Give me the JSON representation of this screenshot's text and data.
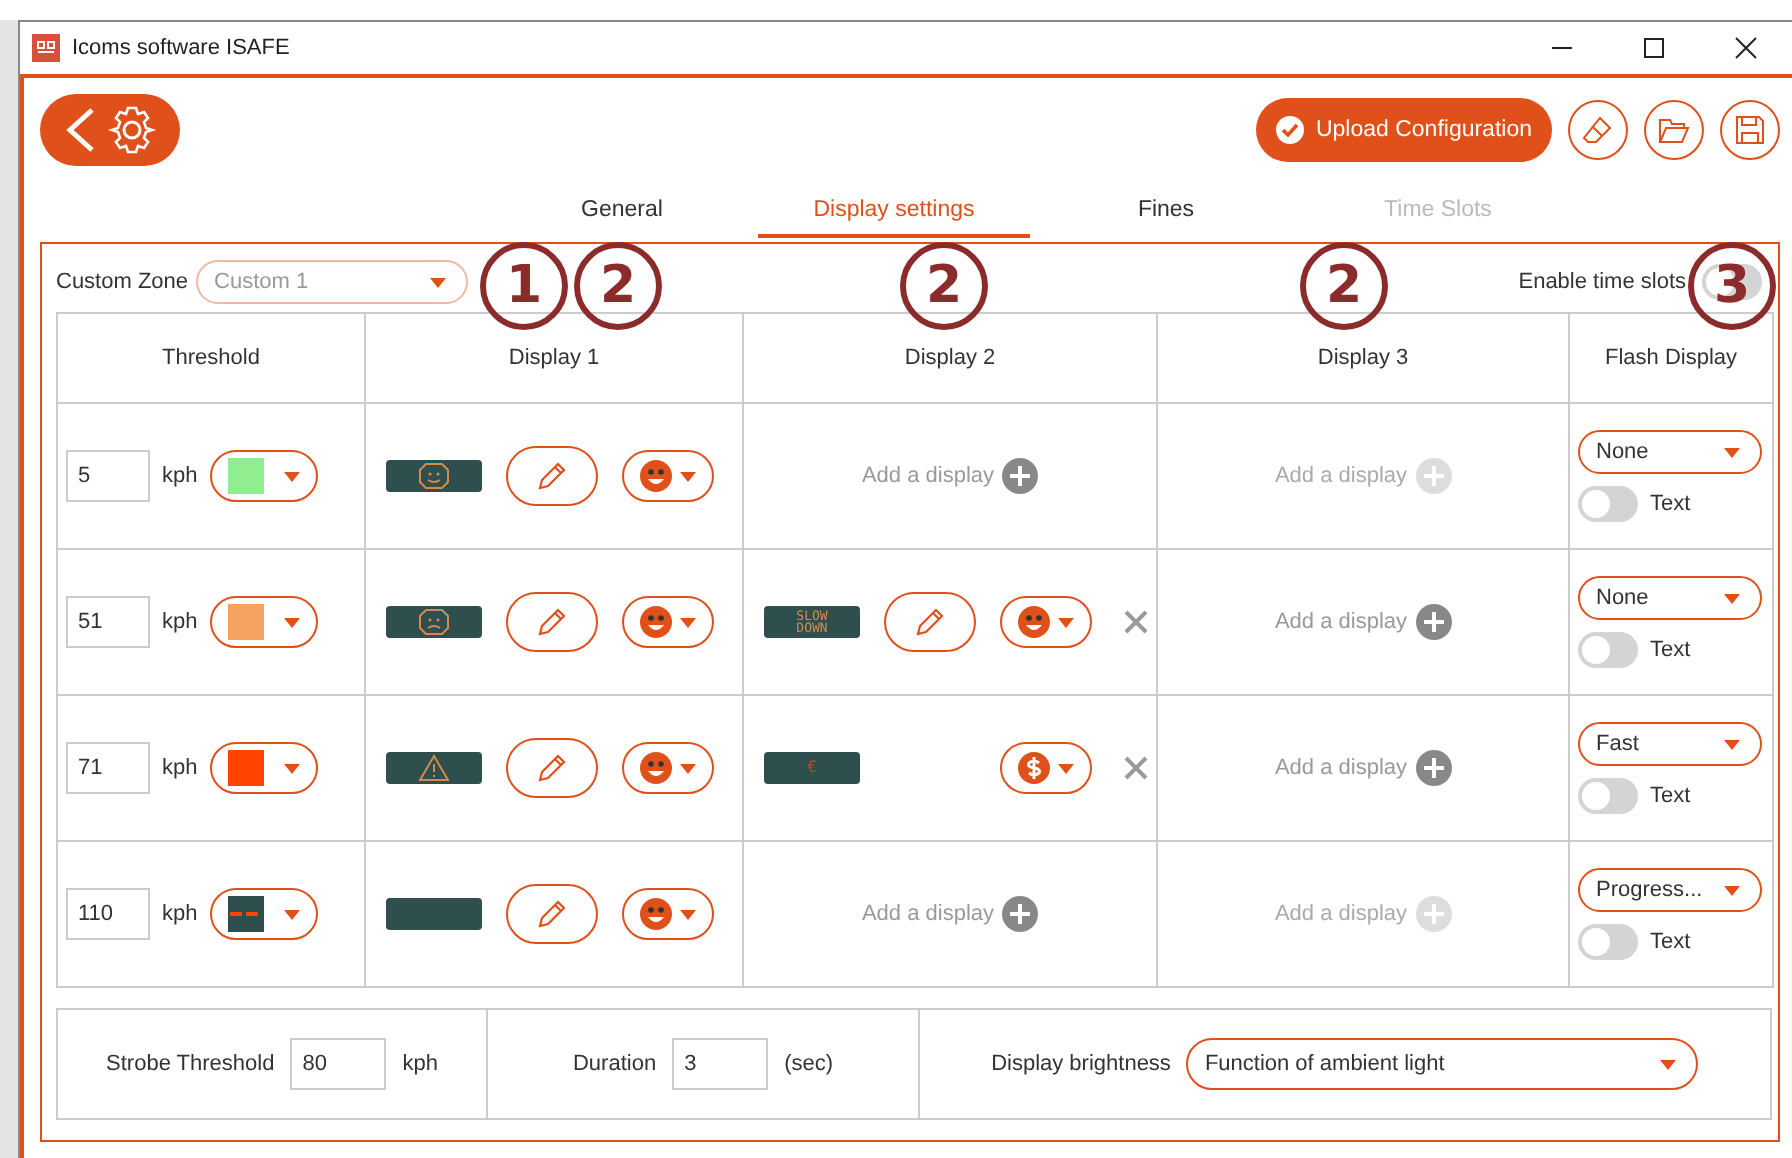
{
  "window": {
    "title": "Icoms software ISAFE"
  },
  "toolbar": {
    "upload_button": "Upload Configuration"
  },
  "tabs": [
    {
      "label": "General",
      "selected": false,
      "disabled": false
    },
    {
      "label": "Display settings",
      "selected": true,
      "disabled": false
    },
    {
      "label": "Fines",
      "selected": false,
      "disabled": false
    },
    {
      "label": "Time Slots",
      "selected": false,
      "disabled": true
    }
  ],
  "custom_zone": {
    "label": "Custom Zone",
    "value": "Custom 1"
  },
  "enable_time_slots": {
    "label": "Enable time slots",
    "on": false
  },
  "table": {
    "columns": [
      "Threshold",
      "Display 1",
      "Display 2",
      "Display 3",
      "Flash Display"
    ],
    "rows": [
      {
        "threshold": "5",
        "unit": "kph",
        "swatch": {
          "kind": "solid",
          "color": "#90ee90"
        },
        "display_1": {
          "kind": "display",
          "preview": {
            "kind": "smile"
          },
          "edit": true,
          "symbol_button": {
            "kind": "smiley"
          }
        },
        "display_2": {
          "kind": "add",
          "label": "Add a display",
          "disabled": false
        },
        "display_3": {
          "kind": "add",
          "label": "Add a display",
          "disabled": true
        },
        "flash": {
          "value": "None",
          "text_label": "Text",
          "text_on": false
        }
      },
      {
        "threshold": "51",
        "unit": "kph",
        "swatch": {
          "kind": "solid",
          "color": "#f4a460"
        },
        "display_1": {
          "kind": "display",
          "preview": {
            "kind": "sad"
          },
          "edit": true,
          "symbol_button": {
            "kind": "smiley"
          }
        },
        "display_2": {
          "kind": "display",
          "preview": {
            "kind": "text",
            "text": "SLOW DOWN"
          },
          "edit": true,
          "symbol_button": {
            "kind": "smiley"
          },
          "removable": true
        },
        "display_3": {
          "kind": "add",
          "label": "Add a display",
          "disabled": false
        },
        "flash": {
          "value": "None",
          "text_label": "Text",
          "text_on": false
        }
      },
      {
        "threshold": "71",
        "unit": "kph",
        "swatch": {
          "kind": "solid",
          "color": "#ff4500"
        },
        "display_1": {
          "kind": "display",
          "preview": {
            "kind": "warning"
          },
          "edit": true,
          "symbol_button": {
            "kind": "smiley"
          }
        },
        "display_2": {
          "kind": "display",
          "preview": {
            "kind": "text",
            "text": "€"
          },
          "edit": false,
          "symbol_button": {
            "kind": "dollar"
          },
          "removable": true
        },
        "display_3": {
          "kind": "add",
          "label": "Add a display",
          "disabled": false
        },
        "flash": {
          "value": "Fast",
          "text_label": "Text",
          "text_on": false
        }
      },
      {
        "threshold": "110",
        "unit": "kph",
        "swatch": {
          "kind": "dashes",
          "color": "#2f4f4f"
        },
        "display_1": {
          "kind": "display",
          "preview": {
            "kind": "blank"
          },
          "edit": true,
          "symbol_button": {
            "kind": "smiley"
          }
        },
        "display_2": {
          "kind": "add",
          "label": "Add a display",
          "disabled": false
        },
        "display_3": {
          "kind": "add",
          "label": "Add a display",
          "disabled": true
        },
        "flash": {
          "value": "Progress...",
          "text_label": "Text",
          "text_on": false
        }
      }
    ]
  },
  "footer": {
    "strobe_label": "Strobe Threshold",
    "strobe_value": "80",
    "strobe_unit": "kph",
    "duration_label": "Duration",
    "duration_value": "3",
    "duration_unit": "(sec)",
    "brightness_label": "Display brightness",
    "brightness_value": "Function of ambient light"
  },
  "annotations": [
    "1",
    "2",
    "2",
    "2",
    "3"
  ]
}
